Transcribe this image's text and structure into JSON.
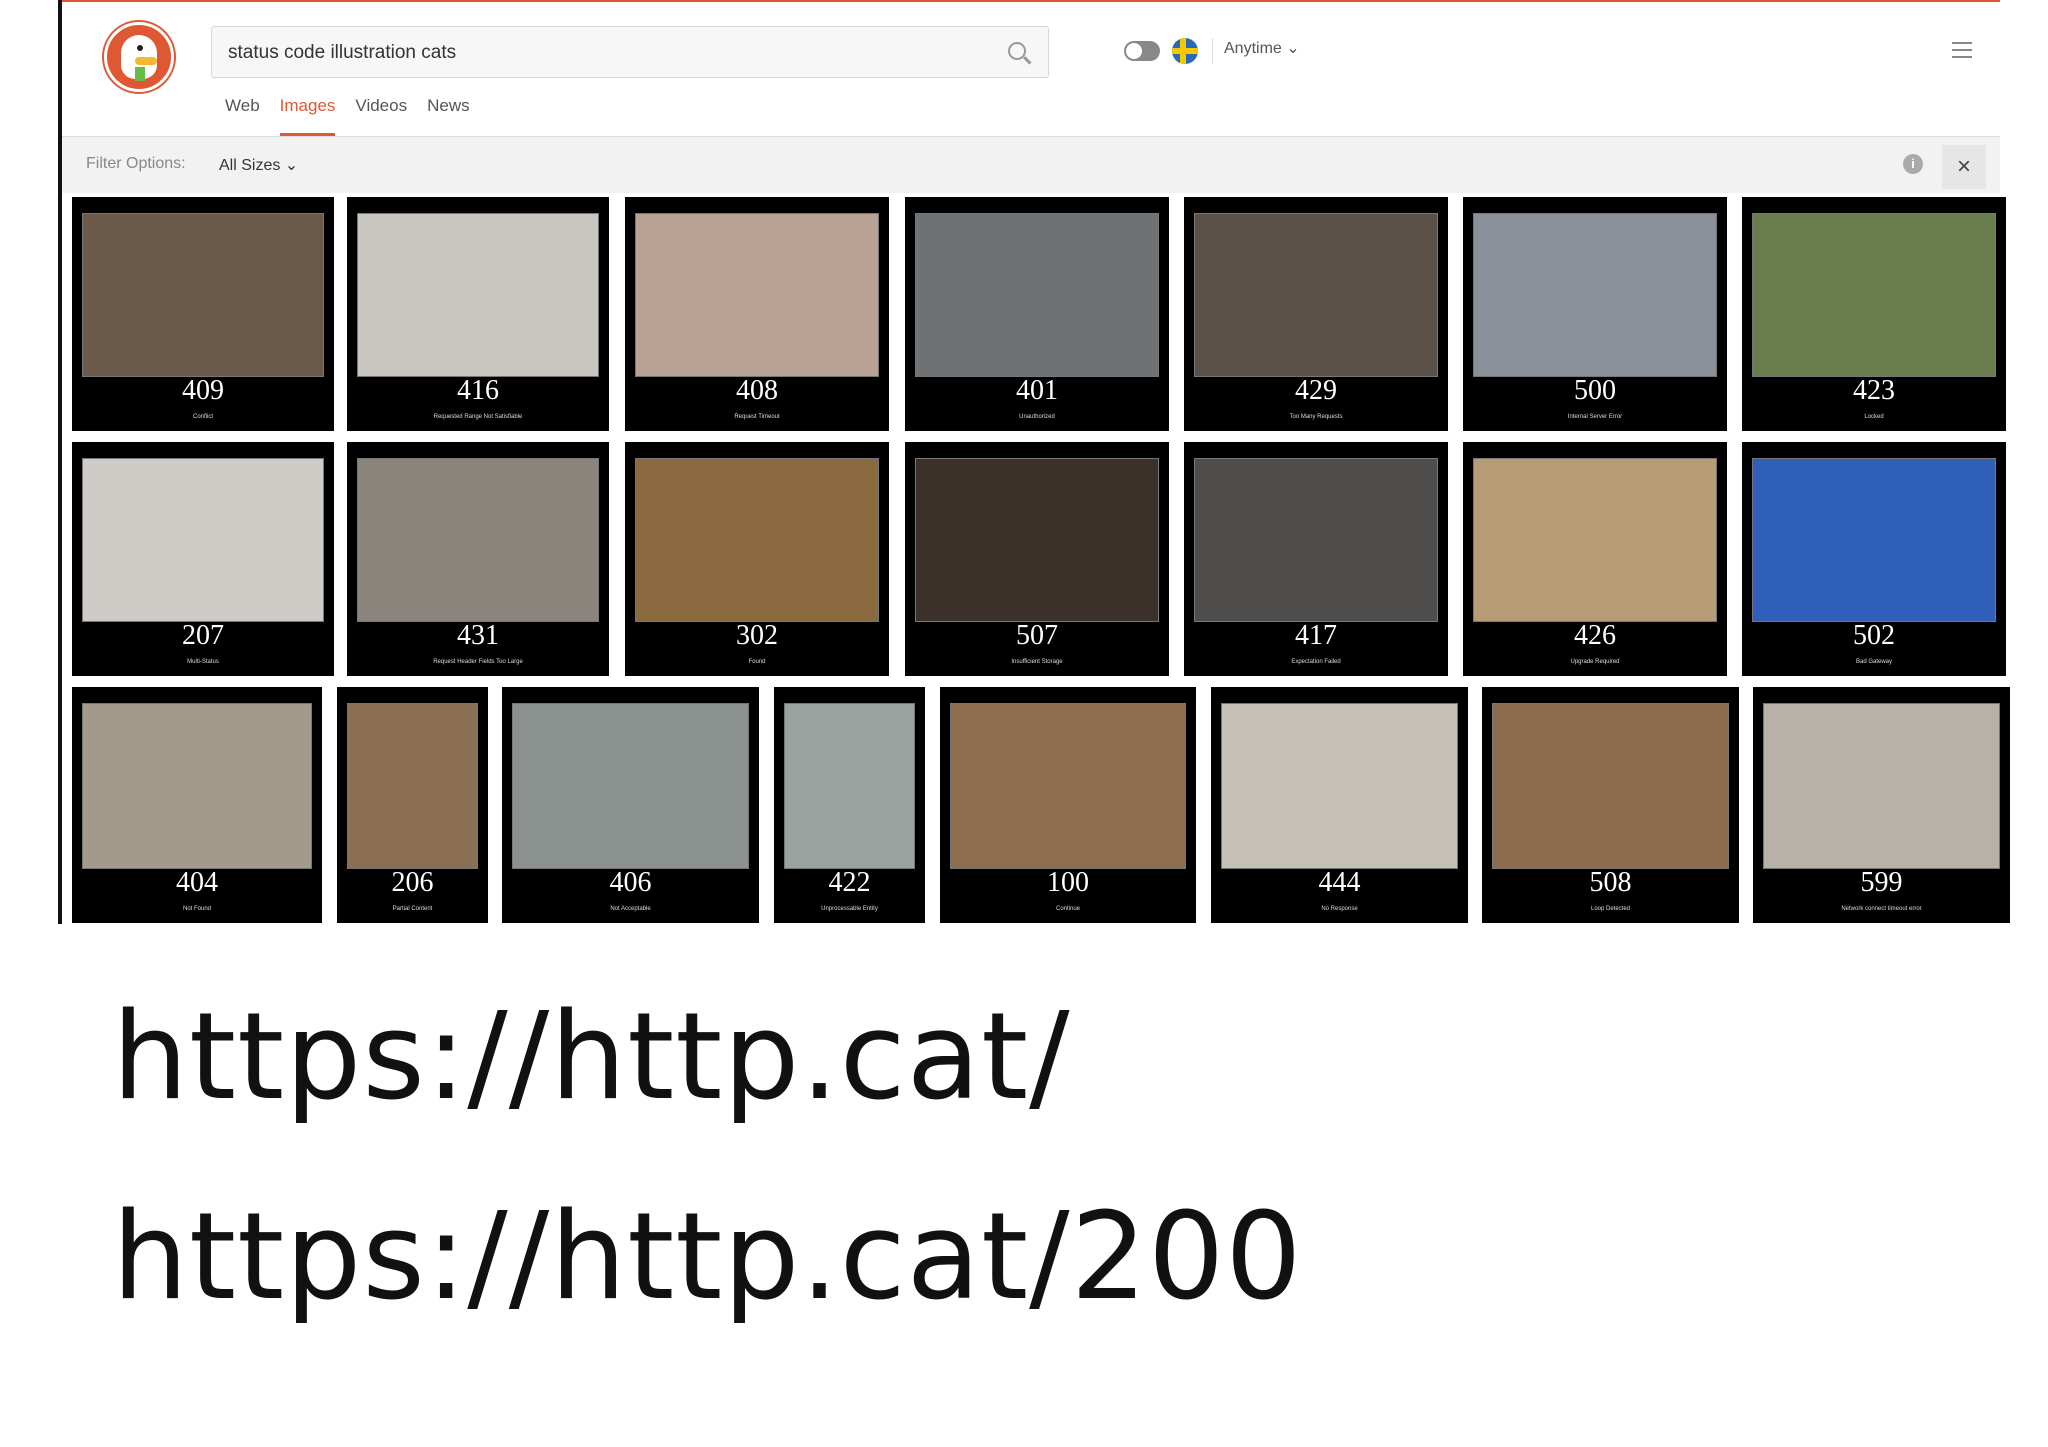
{
  "search": {
    "query": "status code illustration cats"
  },
  "header": {
    "time_filter": "Anytime"
  },
  "tabs": [
    {
      "label": "Web"
    },
    {
      "label": "Images"
    },
    {
      "label": "Videos"
    },
    {
      "label": "News"
    }
  ],
  "filter": {
    "label": "Filter Options:",
    "size": "All Sizes"
  },
  "results": [
    {
      "code": "409",
      "desc": "Conflict",
      "color": "#6b5a4a"
    },
    {
      "code": "416",
      "desc": "Requested Range Not Satisfiable",
      "color": "#c9c6c2"
    },
    {
      "code": "408",
      "desc": "Request Timeout",
      "color": "#b9a293"
    },
    {
      "code": "401",
      "desc": "Unauthorized",
      "color": "#6e7275"
    },
    {
      "code": "429",
      "desc": "Too Many Requests",
      "color": "#5c5148"
    },
    {
      "code": "500",
      "desc": "Internal Server Error",
      "color": "#8a909a"
    },
    {
      "code": "423",
      "desc": "Locked",
      "color": "#6a7d4e"
    },
    {
      "code": "207",
      "desc": "Multi-Status",
      "color": "#cfcbc6"
    },
    {
      "code": "431",
      "desc": "Request Header Fields Too Large",
      "color": "#8b857d"
    },
    {
      "code": "302",
      "desc": "Found",
      "color": "#8c6a3f"
    },
    {
      "code": "507",
      "desc": "Insufficient Storage",
      "color": "#3b302a"
    },
    {
      "code": "417",
      "desc": "Expectation Failed",
      "color": "#4e4d4b"
    },
    {
      "code": "426",
      "desc": "Upgrade Required",
      "color": "#b89c76"
    },
    {
      "code": "502",
      "desc": "Bad Gateway",
      "color": "#2f5fb8"
    },
    {
      "code": "404",
      "desc": "Not Found",
      "color": "#a39a8c"
    },
    {
      "code": "206",
      "desc": "Partial Content",
      "color": "#8a6f55"
    },
    {
      "code": "406",
      "desc": "Not Acceptable",
      "color": "#8a918e"
    },
    {
      "code": "422",
      "desc": "Unprocessable Entity",
      "color": "#9aa2a0"
    },
    {
      "code": "100",
      "desc": "Continue",
      "color": "#8c6e4e"
    },
    {
      "code": "444",
      "desc": "No Response",
      "color": "#c5c0b5"
    },
    {
      "code": "508",
      "desc": "Loop Detected",
      "color": "#8c6b4e"
    },
    {
      "code": "599",
      "desc": "Network connect timeout error",
      "color": "#b7b1a8"
    }
  ],
  "urls": [
    "https://http.cat/",
    "https://http.cat/200"
  ]
}
